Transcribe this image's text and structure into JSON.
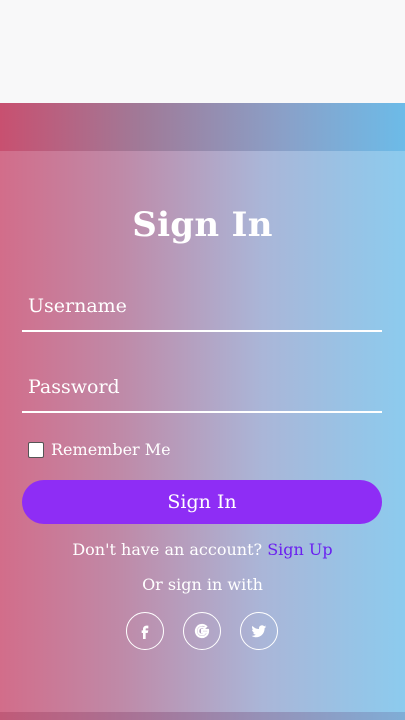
{
  "login": {
    "title": "Sign In",
    "username_placeholder": "Username",
    "password_placeholder": "Password",
    "remember_label": "Remember Me",
    "remember_checked": false,
    "signin_button_label": "Sign In",
    "no_account_text": "Don't have an account?",
    "signup_link_label": "Sign Up",
    "or_text": "Or sign in with"
  },
  "social": {
    "icons": [
      "facebook-icon",
      "google-icon",
      "twitter-icon"
    ]
  },
  "colors": {
    "gradient_left": "#d26d8a",
    "gradient_right": "#8ccbee",
    "primary_button": "#8e2df5",
    "signup_link": "#6a1ff0",
    "text": "#ffffff",
    "page_background": "#f8f8f9"
  }
}
